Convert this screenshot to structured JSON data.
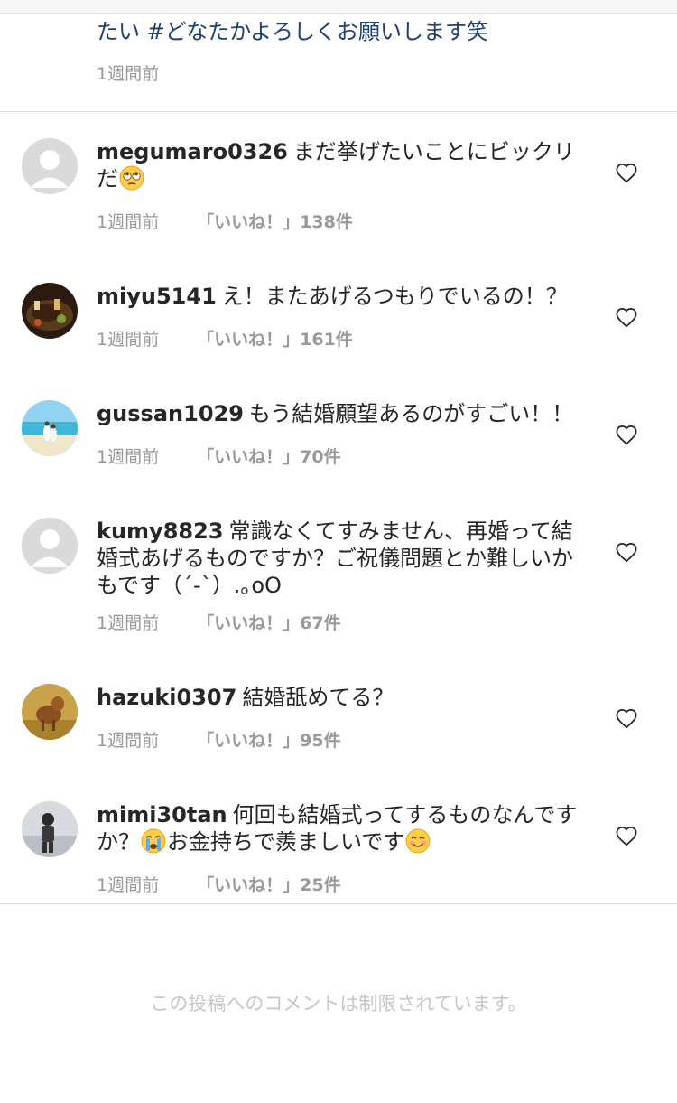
{
  "caption": {
    "text_tail": "たい #どなたかよろしくお願いします笑",
    "time": "1週間前"
  },
  "comments": [
    {
      "username": "megumaro0326",
      "text": "まだ挙げたいことにビックリだ",
      "emoji": "rolling-eyes-emoji",
      "time": "1週間前",
      "likes": "「いいね！」138件"
    },
    {
      "username": "miyu5141",
      "text": "え！またあげるつもりでいるの！？",
      "time": "1週間前",
      "likes": "「いいね！」161件"
    },
    {
      "username": "gussan1029",
      "text": "もう結婚願望あるのがすごい！！",
      "time": "1週間前",
      "likes": "「いいね！」70件"
    },
    {
      "username": "kumy8823",
      "text": "常識なくてすみません、再婚って結婚式あげるものですか？ご祝儀問題とか難しいかもです（´-`）.｡oO",
      "time": "1週間前",
      "likes": "「いいね！」67件"
    },
    {
      "username": "hazuki0307",
      "text": "結婚舐めてる？",
      "time": "1週間前",
      "likes": "「いいね！」95件"
    },
    {
      "username": "mimi30tan",
      "text_a": "何回も結婚式ってするものなんですか？",
      "text_b": "お金持ちで羨ましいです",
      "emoji_a": "crying-emoji",
      "emoji_b": "smiling-emoji",
      "time": "1週間前",
      "likes": "「いいね！」25件"
    }
  ],
  "footer": {
    "comments_disabled": "この投稿へのコメントは制限されています。"
  }
}
